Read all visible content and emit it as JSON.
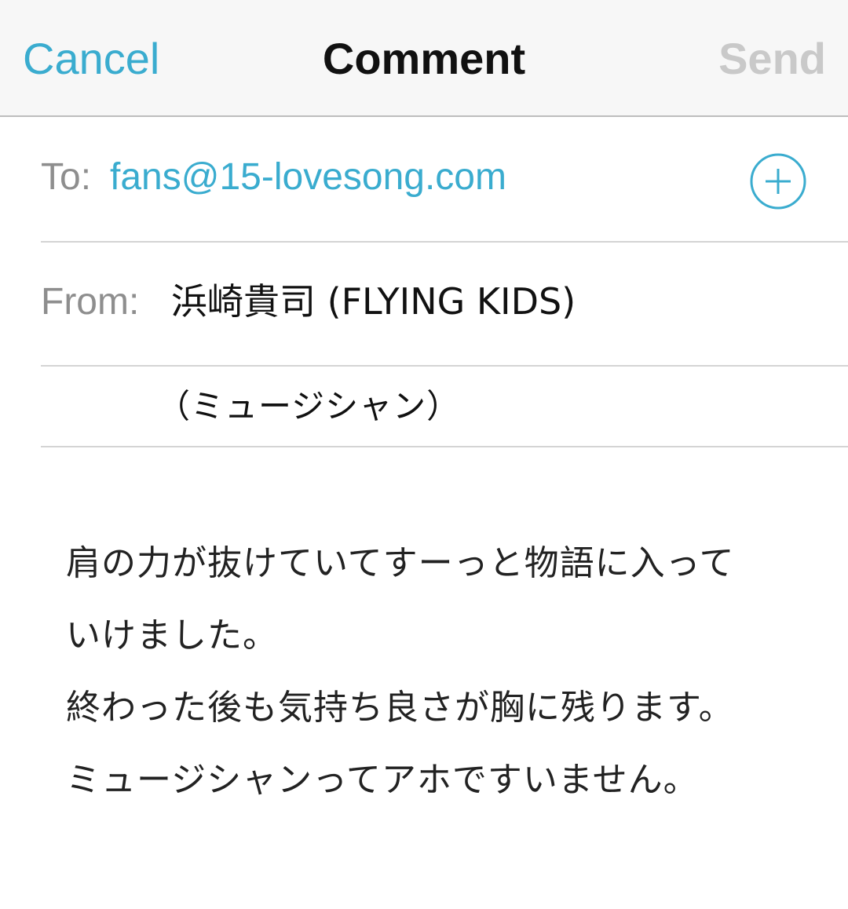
{
  "theme": {
    "accent": "#3aaccf",
    "disabled": "#c9c9c9"
  },
  "navbar": {
    "cancel_label": "Cancel",
    "title": "Comment",
    "send_label": "Send"
  },
  "to": {
    "label": "To:",
    "value": "fans@15-lovesong.com",
    "add_icon": "plus-circle-icon"
  },
  "from": {
    "label": "From:",
    "value": "浜崎貴司 (FLYING KIDS)",
    "subtitle": "（ミュージシャン）"
  },
  "message": {
    "lines": [
      "肩の力が抜けていてすーっと物語に入って",
      "いけました。",
      "終わった後も気持ち良さが胸に残ります。",
      "ミュージシャンってアホですいません。"
    ]
  }
}
